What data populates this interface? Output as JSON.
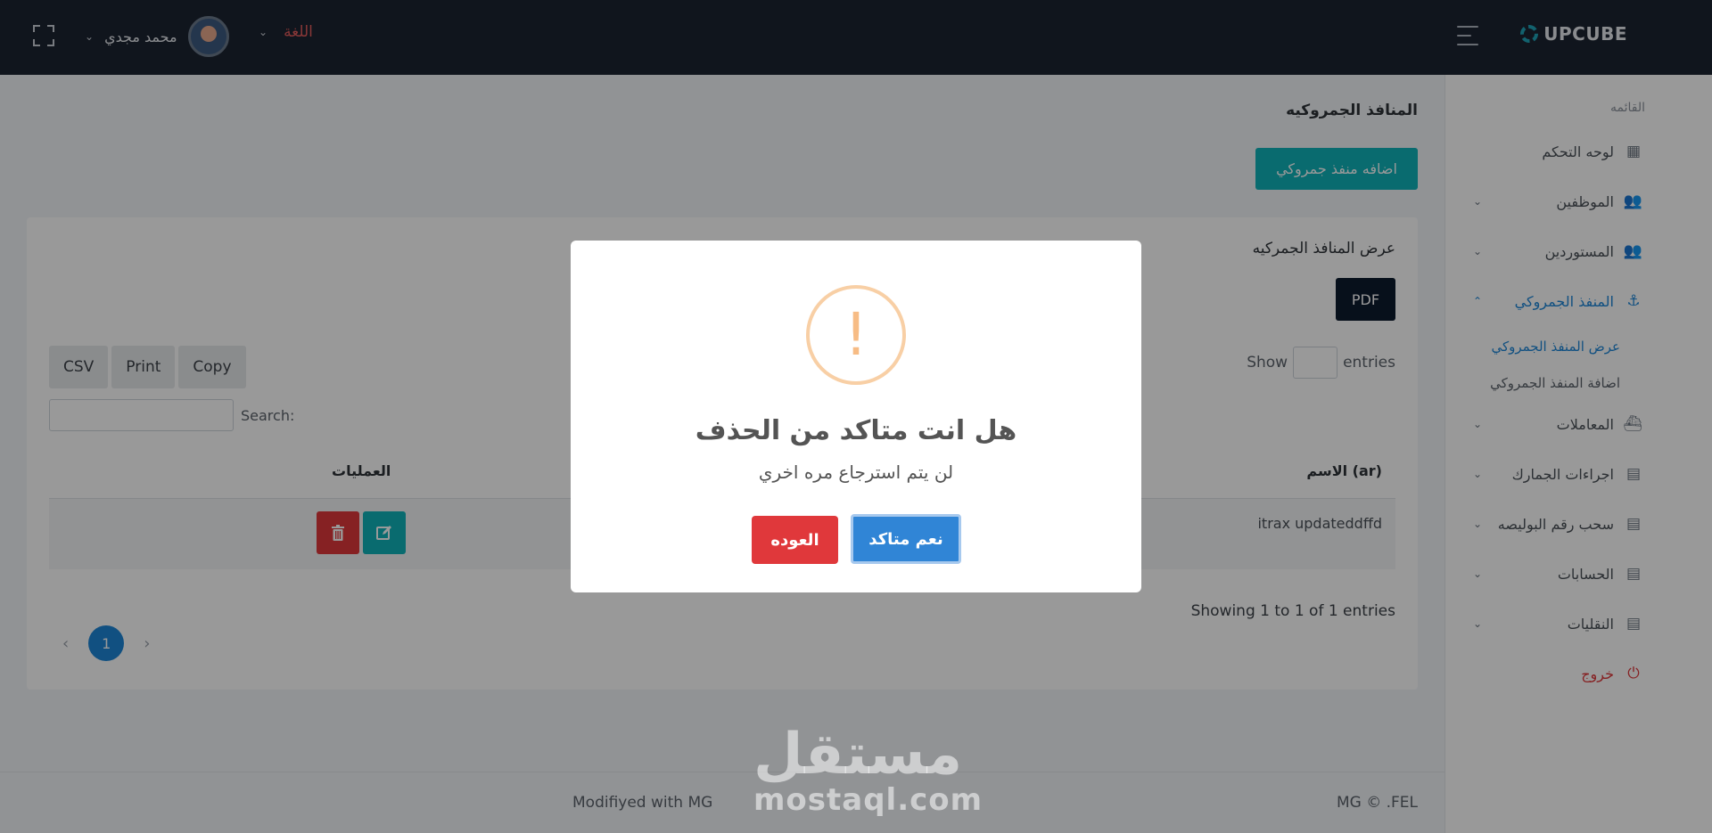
{
  "header": {
    "brand": "UPCUBE",
    "language_label": "اللغة",
    "user_name": "محمد مجدي"
  },
  "sidebar": {
    "menu_title": "القائمه",
    "items": [
      {
        "label": "لوحه التحكم",
        "icon": "dashboard-icon"
      },
      {
        "label": "الموظفين",
        "icon": "users-icon"
      },
      {
        "label": "المستوردين",
        "icon": "users-icon"
      },
      {
        "label": "المنفذ الجمروكي",
        "icon": "anchor-icon"
      },
      {
        "label": "المعاملات",
        "icon": "ship-icon"
      },
      {
        "label": "اجراءات الجمارك",
        "icon": "list-icon"
      },
      {
        "label": "سحب رقم البوليصه",
        "icon": "list-icon"
      },
      {
        "label": "الحسابات",
        "icon": "list-icon"
      },
      {
        "label": "النقليات",
        "icon": "list-icon"
      },
      {
        "label": "خروج",
        "icon": "power-icon"
      }
    ],
    "sub_items": [
      "عرض المنفذ الجمروكي",
      "اضافة المنفذ الجمروكي"
    ]
  },
  "main": {
    "page_title": "المنافذ الجمروكيه",
    "add_button": "اضافه منفذ جمروكي",
    "card_title": "عرض المنافذ الجمركيه",
    "pdf_button": "PDF",
    "show_label": "Show",
    "entries_label": "entries",
    "export_buttons": [
      "CSV",
      "Print",
      "Copy"
    ],
    "search_label": "Search:",
    "columns": {
      "name": "الاسم (ar)",
      "operations": "العمليات"
    },
    "rows": [
      {
        "name": "itrax updateddffd"
      }
    ],
    "showing_text": "Showing 1 to 1 of 1 entries",
    "pagination": {
      "current_page": "1",
      "prev": "‹",
      "next": "›"
    }
  },
  "footer": {
    "left": "Modifiyed with MG",
    "right": "MG © .FEL"
  },
  "watermark": {
    "arabic": "مستقل",
    "english": "mostaql.com"
  },
  "modal": {
    "icon": "!",
    "title": "هل انت متاكد من الحذف",
    "text": "لن يتم استرجاع مره اخري",
    "confirm_label": "نعم متاكد",
    "cancel_label": "العوده"
  },
  "colors": {
    "topbar": "#1c2331",
    "accent_teal": "#0fb2b9",
    "primary_blue": "#1d86d7",
    "danger_red": "#e0383b",
    "warning_orange": "#f8cfa5"
  }
}
